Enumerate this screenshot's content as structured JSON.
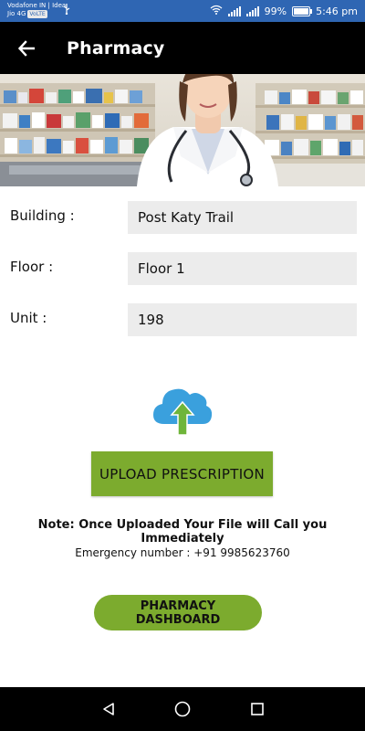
{
  "status_bar": {
    "carrier_line1": "Vodafone IN | Idea",
    "carrier_line2": "Jio 4G",
    "volte": "VoLTE",
    "battery": "99%",
    "time": "5:46 pm",
    "icons": [
      "usb-icon",
      "wifi-icon",
      "signal-icon",
      "battery-icon"
    ]
  },
  "app_bar": {
    "title": "Pharmacy",
    "back_icon": "arrow-left-icon"
  },
  "banner": {
    "image": "pharmacist-banner"
  },
  "form": {
    "building": {
      "label": "Building :",
      "value": "Post Katy Trail"
    },
    "floor": {
      "label": "Floor :",
      "value": "Floor 1"
    },
    "unit": {
      "label": "Unit :",
      "value": "198"
    }
  },
  "upload": {
    "icon": "cloud-upload-icon",
    "button_label": "UPLOAD PRESCRIPTION",
    "note": "Note: Once Uploaded Your File will Call you Immediately",
    "emergency": "Emergency number : +91 9985623760"
  },
  "dashboard_button_label": "PHARMACY DASHBOARD",
  "nav_bar": {
    "icons": [
      "back-triangle-icon",
      "home-circle-icon",
      "recents-square-icon"
    ]
  },
  "colors": {
    "status_bar": "#2f66b3",
    "app_bar": "#000000",
    "accent_green": "#7cab2e",
    "field_bg": "#ececec",
    "cloud_blue": "#3aa0dd",
    "arrow_green": "#6fb53a"
  }
}
